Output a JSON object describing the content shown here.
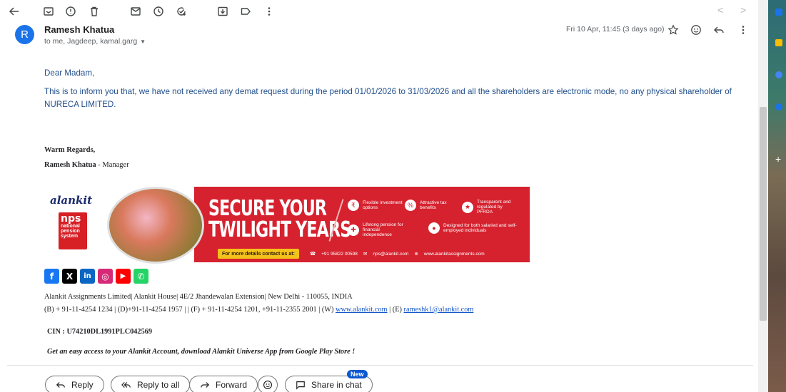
{
  "toolbar": {
    "back_icon": "arrow-back-icon",
    "icons": [
      "archive-icon",
      "report-spam-icon",
      "delete-icon",
      "mark-unread-icon",
      "snooze-icon",
      "add-task-icon",
      "move-to-icon",
      "label-icon",
      "more-vert-icon"
    ],
    "prev_glyph": "<",
    "next_glyph": ">"
  },
  "header": {
    "avatar_letter": "R",
    "avatar_color": "#1a73e8",
    "sender": "Ramesh Khatua",
    "recipients": "to me, Jagdeep, kamal.garg",
    "date": "Fri 10 Apr, 11:45 (3 days ago)"
  },
  "body": {
    "greeting": "Dear Madam,",
    "paragraph": "This is to inform you that, we have not received any demat request during the period 01/01/2026 to 31/03/2026 and all the shareholders are electronic mode, no any physical shareholder of NURECA LIMITED."
  },
  "signature": {
    "regards": "Warm Regards,",
    "name": "Ramesh Khatua",
    "title": " - Manager"
  },
  "banner": {
    "logo_text": "alankit",
    "nps_big": "nps",
    "nps_lines": [
      "national",
      "pension",
      "system"
    ],
    "headline_1": "SECURE YOUR",
    "headline_2": "TWILIGHT YEARS",
    "features": [
      "Flexible investment options",
      "Attractive tax benefits",
      "Transparent and regulated by PFRDA",
      "Lifelong pension for financial independence",
      "Designed for both salaried and self-employed individuals"
    ],
    "contact_label": "For more details contact us at:",
    "phone": "+91 95822 00598",
    "email": "nps@alankit.com",
    "website": "www.alankitassignments.com",
    "brand_red": "#d6222f",
    "accent_yellow": "#f4c21a"
  },
  "social": [
    {
      "name": "facebook-icon",
      "glyph": "f",
      "color": "#1877f2"
    },
    {
      "name": "x-icon",
      "glyph": "X",
      "color": "#000000"
    },
    {
      "name": "linkedin-icon",
      "glyph": "in",
      "color": "#0a66c2"
    },
    {
      "name": "instagram-icon",
      "glyph": "◎",
      "color": "#d62976"
    },
    {
      "name": "youtube-icon",
      "glyph": "▶",
      "color": "#ff0000"
    },
    {
      "name": "whatsapp-icon",
      "glyph": "✆",
      "color": "#25d366"
    }
  ],
  "address": {
    "line1": "Alankit Assignments Limited| Alankit House| 4E/2 Jhandewalan Extension| New Delhi - 110055, INDIA",
    "line2_prefix": "(B) + 91-11-4254 1234 | (D)+91-11-4254 1957 | | (F) + 91-11-4254 1201, +91-11-2355 2001 | (W) ",
    "website": "www.alankit.com",
    "line2_mid": " | (E) ",
    "email": "rameshk1@alankit.com",
    "cin": "CIN : U74210DL1991PLC042569",
    "promo": "Get an easy access to your Alankit Account, download Alankit Universe App from Google Play Store !"
  },
  "actions": {
    "reply": "Reply",
    "reply_all": "Reply to all",
    "forward": "Forward",
    "share": "Share in chat",
    "new_badge": "New"
  }
}
